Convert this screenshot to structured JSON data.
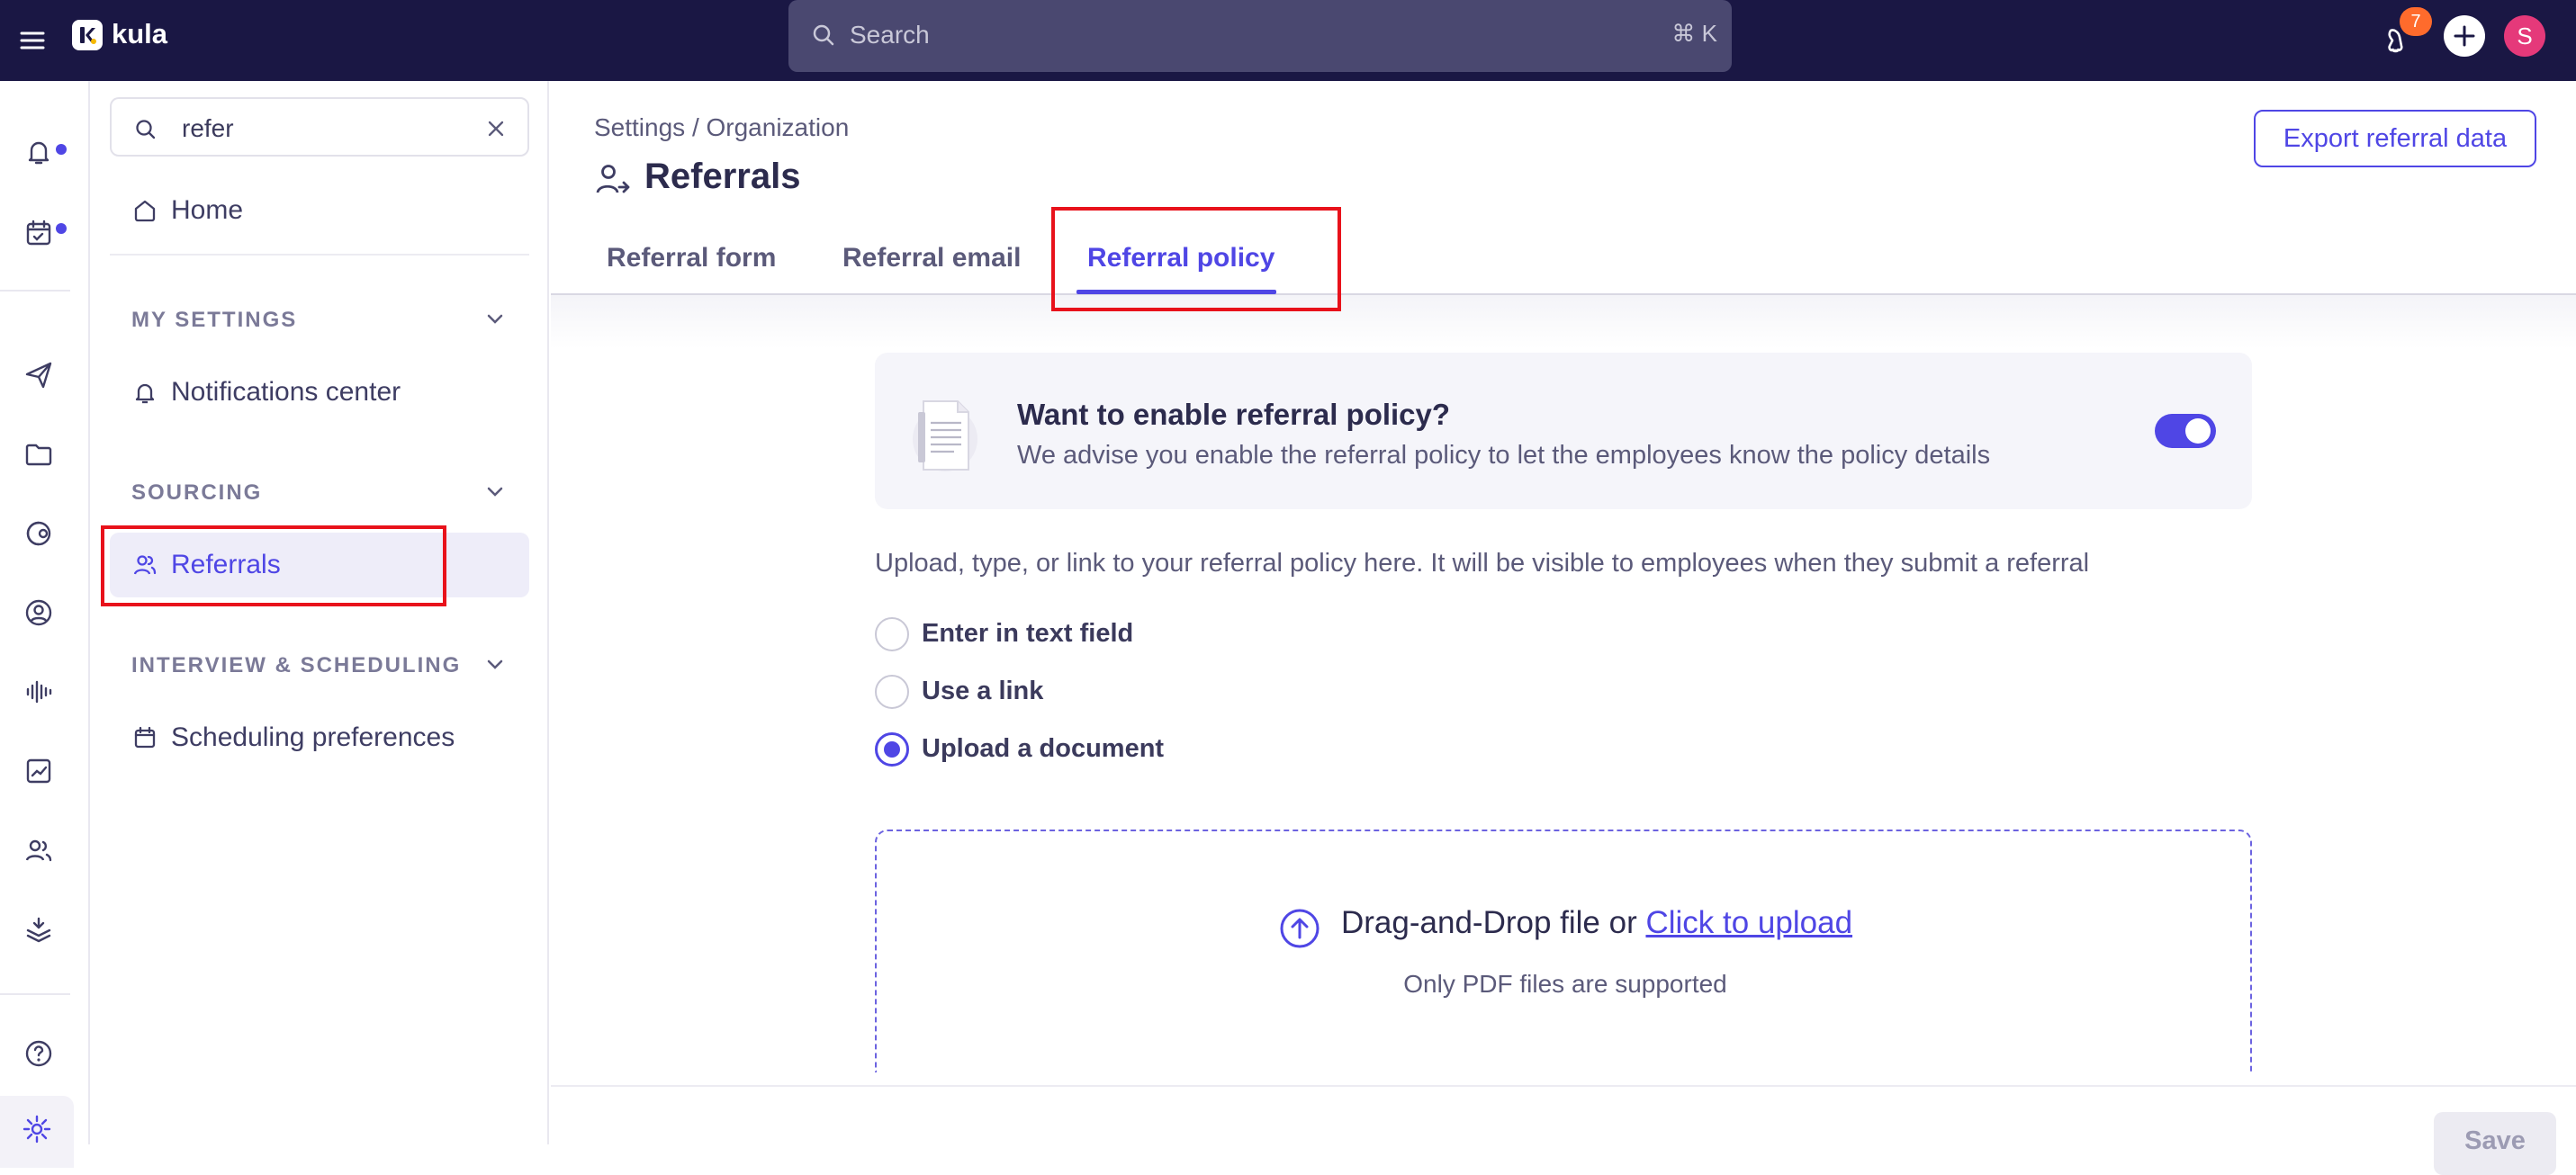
{
  "topbar": {
    "app_name": "kula",
    "search_placeholder": "Search",
    "search_shortcut": "⌘ K",
    "notification_count": "7",
    "user_initial": "S"
  },
  "nav": {
    "search_value": "refer",
    "home_label": "Home",
    "sections": {
      "my_settings": {
        "title": "MY SETTINGS",
        "item": "Notifications center"
      },
      "sourcing": {
        "title": "SOURCING",
        "item": "Referrals"
      },
      "interview": {
        "title": "INTERVIEW & SCHEDULING",
        "item": "Scheduling preferences"
      }
    }
  },
  "main": {
    "breadcrumb": "Settings / Organization",
    "title": "Referrals",
    "export_label": "Export referral data",
    "tabs": [
      "Referral form",
      "Referral email",
      "Referral policy"
    ],
    "active_tab": "Referral policy",
    "card": {
      "title": "Want to enable referral policy?",
      "subtitle": "We advise you enable the referral policy to let the employees know the policy details",
      "enabled": true
    },
    "intro": "Upload, type, or link to your referral policy here. It will be visible to employees when they submit a referral",
    "options": [
      "Enter in text field",
      "Use a link",
      "Upload a document"
    ],
    "selected_option": "Upload a document",
    "upload": {
      "text": "Drag-and-Drop file or ",
      "link": "Click to upload",
      "note": "Only PDF files are supported"
    },
    "save_label": "Save"
  },
  "colors": {
    "accent": "#4f46e5",
    "topbar": "#1a1744",
    "highlight": "#e8121b",
    "badge": "#ff6b2c",
    "avatar": "#e5397a"
  }
}
